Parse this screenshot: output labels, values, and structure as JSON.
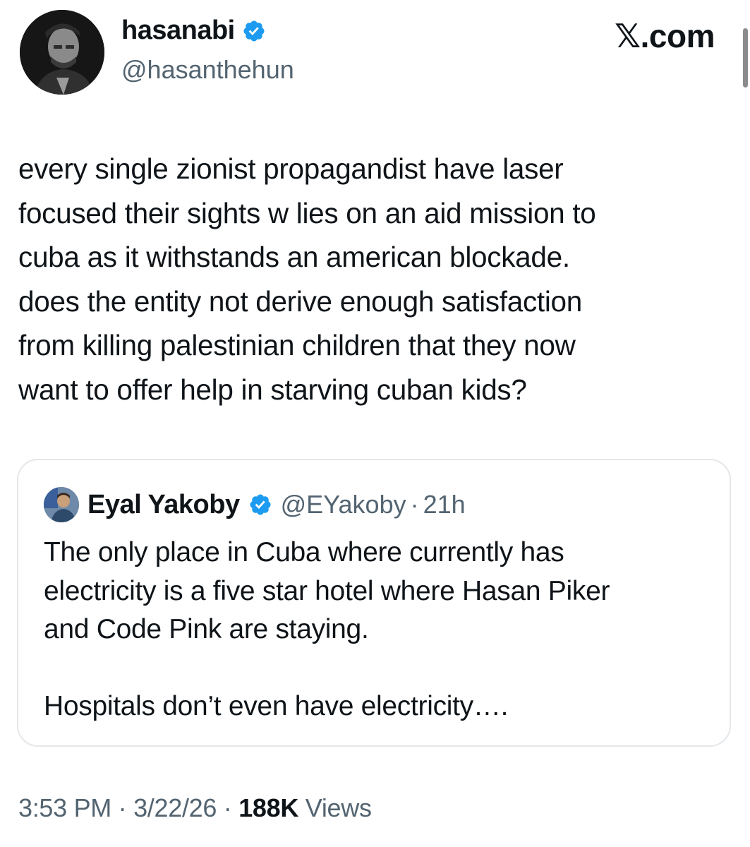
{
  "colors": {
    "text": "#0f1419",
    "secondary": "#536471",
    "verified": "#1d9bf0",
    "border": "#e4e7ea"
  },
  "brand": "𝕏.com",
  "author": {
    "display_name": "hasanabi",
    "handle": "@hasanthehun",
    "verified_icon": "verified-badge-icon"
  },
  "tweet": {
    "text": "every single zionist propagandist have laser\nfocused their sights w lies on an aid mission to\ncuba as it withstands an american blockade.\ndoes the entity not derive enough satisfaction\nfrom killing palestinian children that they now\nwant to offer help in starving cuban kids?"
  },
  "quote": {
    "display_name": "Eyal Yakoby",
    "handle": "@EYakoby",
    "separator": "·",
    "time": "21h",
    "text": "The only place in Cuba where currently has\nelectricity is a five star hotel where Hasan Piker\nand Code Pink are staying.\n\nHospitals don’t even have electricity…."
  },
  "meta": {
    "time": "3:53 PM",
    "separator": "·",
    "date": "3/22/26",
    "views_count": "188K",
    "views_label": "Views"
  }
}
